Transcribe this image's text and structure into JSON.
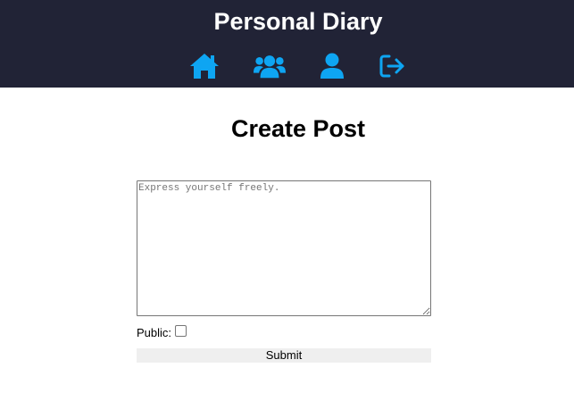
{
  "header": {
    "title": "Personal Diary",
    "accent_color": "#0ea5f2",
    "background_color": "#212336",
    "nav": [
      {
        "icon": "home-icon"
      },
      {
        "icon": "users-icon"
      },
      {
        "icon": "user-icon"
      },
      {
        "icon": "logout-icon"
      }
    ]
  },
  "main": {
    "title": "Create Post",
    "textarea_placeholder": "Express yourself freely.",
    "textarea_value": "",
    "public_label": "Public:",
    "public_checked": false,
    "submit_label": "Submit"
  }
}
